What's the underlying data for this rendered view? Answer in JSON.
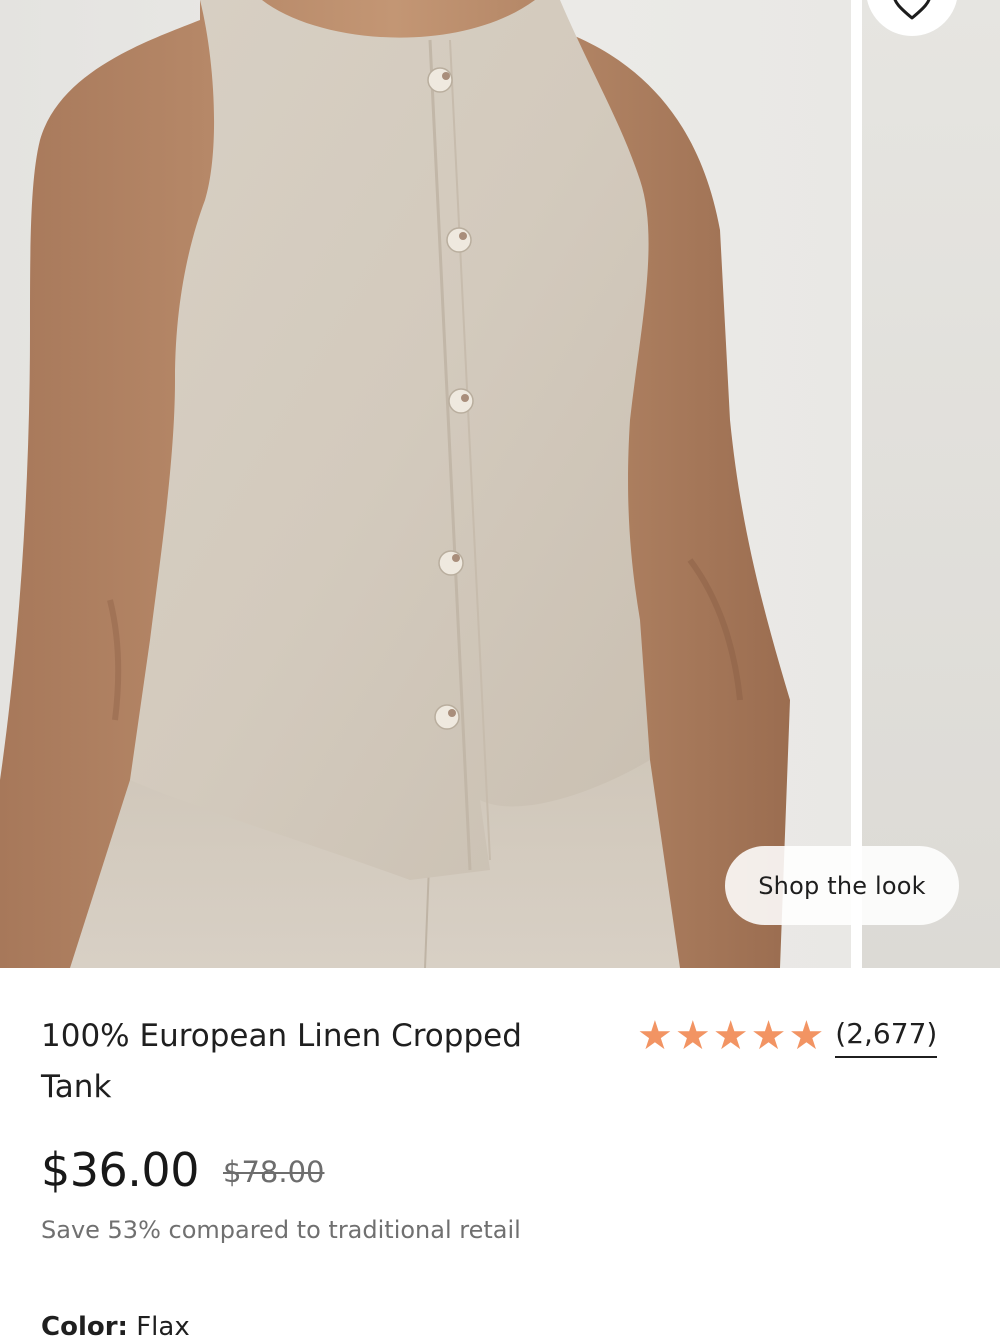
{
  "gallery": {
    "shop_the_look_label": "Shop the look",
    "wishlist_icon": "heart-icon"
  },
  "product": {
    "title": "100% European Linen Cropped Tank",
    "rating": {
      "stars": 5,
      "star_color": "#f29463",
      "review_count": "(2,677)"
    },
    "price": "$36.00",
    "compare_at_price": "$78.00",
    "savings_text": "Save 53% compared to traditional retail",
    "color_label": "Color:",
    "color_value": "Flax"
  }
}
